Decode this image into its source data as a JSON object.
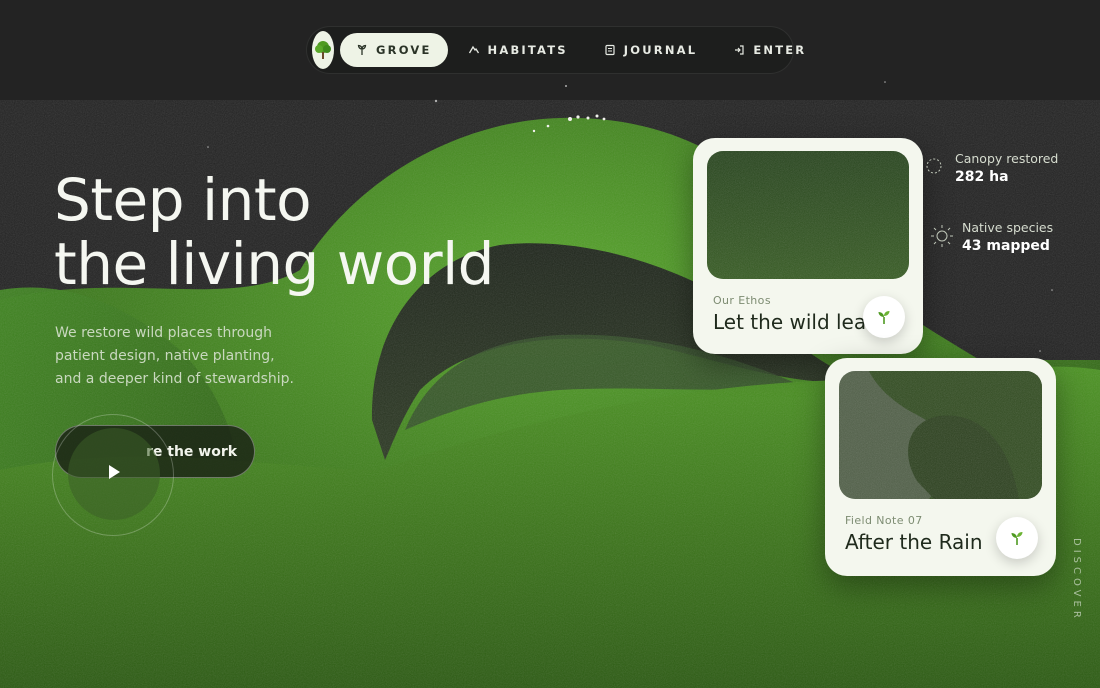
{
  "nav": {
    "logo_icon": "tree-icon",
    "items": [
      {
        "label": "GROVE",
        "icon": "sprout-icon",
        "active": true
      },
      {
        "label": "HABITATS",
        "icon": "mountain-icon",
        "active": false
      },
      {
        "label": "JOURNAL",
        "icon": "journal-icon",
        "active": false
      },
      {
        "label": "ENTER",
        "icon": "enter-icon",
        "active": false
      }
    ]
  },
  "hero": {
    "title_line1": "Step into",
    "title_line2": "the living world",
    "desc_line1": "We restore wild places through",
    "desc_line2": "patient design, native planting,",
    "desc_line3": "and a deeper kind of stewardship.",
    "cta_label": "re the work",
    "play_icon": "play-icon"
  },
  "cards": [
    {
      "kicker": "Our Ethos",
      "title": "Let the wild lead",
      "badge_icon": "seedling-icon"
    },
    {
      "kicker": "Field Note 07",
      "title": "After the Rain",
      "badge_icon": "seedling-icon"
    }
  ],
  "stats": [
    {
      "label": "Canopy restored",
      "value": "282 ha",
      "icon": "canopy-icon"
    },
    {
      "label": "Native species",
      "value": "43 mapped",
      "icon": "sun-icon"
    }
  ],
  "discover": "DISCOVER",
  "colors": {
    "background": "#242424",
    "grass": "#3f7d1e",
    "card": "#f4f7ee",
    "accent": "#4f9a22"
  }
}
